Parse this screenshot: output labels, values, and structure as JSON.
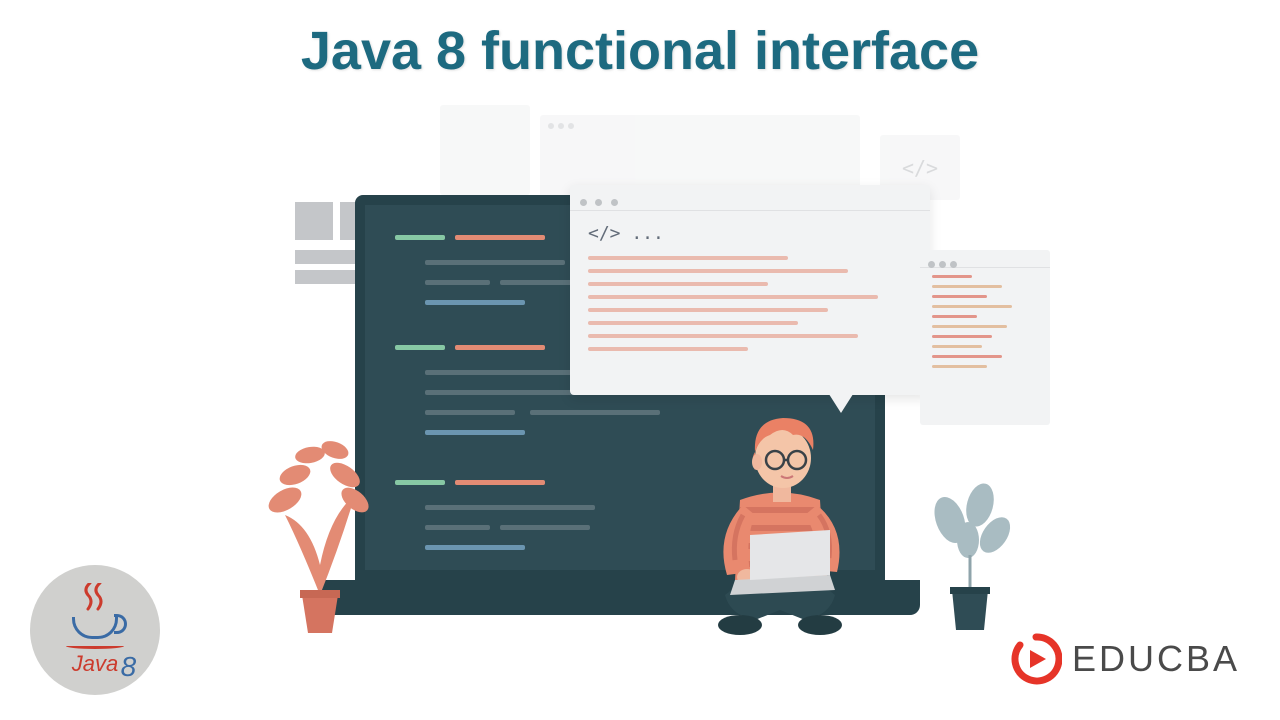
{
  "page": {
    "title": "Java 8 functional interface"
  },
  "illustration": {
    "code_bubble_text": "</> ...",
    "bg_code_icon": "</>"
  },
  "badges": {
    "java": {
      "label": "Java",
      "version": "8"
    }
  },
  "brand": {
    "name": "EDUCBA"
  },
  "colors": {
    "title": "#1d6a80",
    "screen_bg": "#2f4c55",
    "screen_border": "#26424a",
    "accent_orange": "#e38b74",
    "accent_green": "#87c8a4",
    "accent_blue": "#6b95b0",
    "brand_red": "#e63428",
    "java_red": "#cc3b2d",
    "java_blue": "#3a6ba5"
  }
}
